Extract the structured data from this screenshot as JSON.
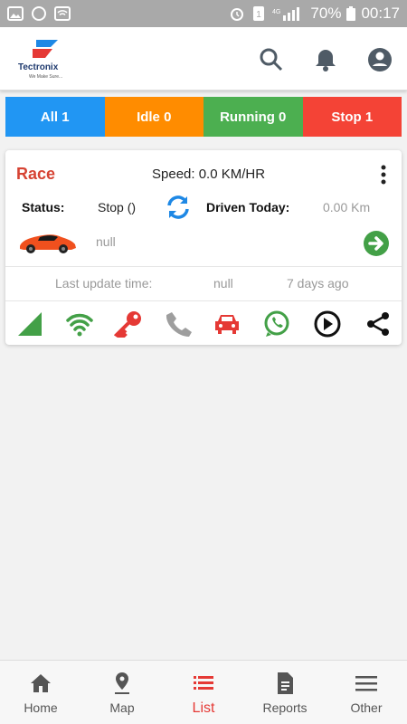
{
  "statusbar": {
    "battery": "70%",
    "time": "00:17"
  },
  "header": {
    "logo_name": "Tectronix",
    "logo_tagline": "We Make Sure..."
  },
  "filters": [
    {
      "label": "All 1",
      "color": "#2196f3"
    },
    {
      "label": "Idle 0",
      "color": "#ff8c00"
    },
    {
      "label": "Running 0",
      "color": "#4caf50"
    },
    {
      "label": "Stop 1",
      "color": "#f44336"
    }
  ],
  "vehicle": {
    "name": "Race",
    "speed": "Speed: 0.0 KM/HR",
    "status_label": "Status:",
    "status_value": "Stop ()",
    "driven_label": "Driven Today:",
    "driven_value": "0.00 Km",
    "address": "null",
    "last_update_label": "Last update time:",
    "last_update_value": "null",
    "last_update_ago": "7 days ago"
  },
  "bottom_nav": [
    {
      "label": "Home",
      "icon": "home-icon"
    },
    {
      "label": "Map",
      "icon": "map-pin-icon"
    },
    {
      "label": "List",
      "icon": "list-icon",
      "active": true
    },
    {
      "label": "Reports",
      "icon": "report-icon"
    },
    {
      "label": "Other",
      "icon": "menu-icon"
    }
  ]
}
